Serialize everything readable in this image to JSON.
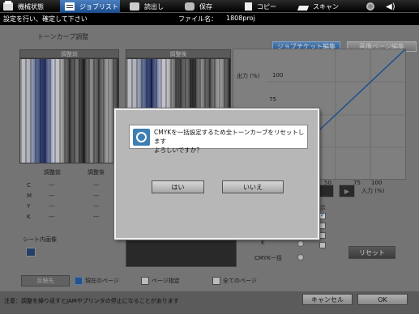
{
  "topbar": {
    "items": [
      {
        "label": "機械状態",
        "icon": "printer-icon"
      },
      {
        "label": "ジョブリスト",
        "icon": "job-list-icon"
      },
      {
        "label": "読出し",
        "icon": "tray-icon"
      },
      {
        "label": "保存",
        "icon": "hdd-icon"
      },
      {
        "label": "コピー",
        "icon": "copy-icon"
      },
      {
        "label": "スキャン",
        "icon": "scan-icon"
      }
    ],
    "speaker_glyph": "◀)"
  },
  "titlebar": {
    "instruction": "設定を行い、確定して下さい",
    "file_label": "ファイル名：",
    "file_name": "1808proj"
  },
  "tabs": {
    "job_ticket": "ジョブチケット編集",
    "page_edit": "画像ページ編集"
  },
  "panel": {
    "title": "トーンカーブ調整",
    "before_label": "調整前",
    "after_label": "調整後",
    "graph": {
      "output_label": "出力 (%)",
      "output_100": "100",
      "output_75": "75",
      "input_label": "入力 (%)",
      "input_50": "50",
      "input_75": "75",
      "input_100": "100"
    },
    "table": {
      "before_col": "調整前",
      "after_col": "調整後",
      "rows": [
        {
          "ch": "C",
          "before": "---",
          "after": "---"
        },
        {
          "ch": "M",
          "before": "---",
          "after": "---"
        },
        {
          "ch": "Y",
          "before": "---",
          "after": "---"
        },
        {
          "ch": "K",
          "before": "---",
          "after": "---"
        }
      ]
    },
    "display_label": "表示",
    "k_label": "K",
    "cmyk_all_label": "CMYK一括",
    "reset_button": "リセット",
    "sheet_label": "シート内画像"
  },
  "apply": {
    "label": "反映先",
    "options": [
      {
        "label": "現在のページ",
        "checked": true
      },
      {
        "label": "ページ指定",
        "checked": false
      },
      {
        "label": "全てのページ",
        "checked": false
      }
    ]
  },
  "footer": {
    "note": "注意：調整を繰り返すとJAMやプリンタの停止になることがあります",
    "cancel": "キャンセル",
    "ok": "OK"
  },
  "dialog": {
    "message_line1": "CMYKを一括設定するため全トーンカーブをリセットします",
    "message_line2": "よろしいですか？",
    "yes": "はい",
    "no": "いいえ"
  },
  "colors": {
    "accent": "#2a66ad",
    "curve": "#1f5fb0"
  }
}
